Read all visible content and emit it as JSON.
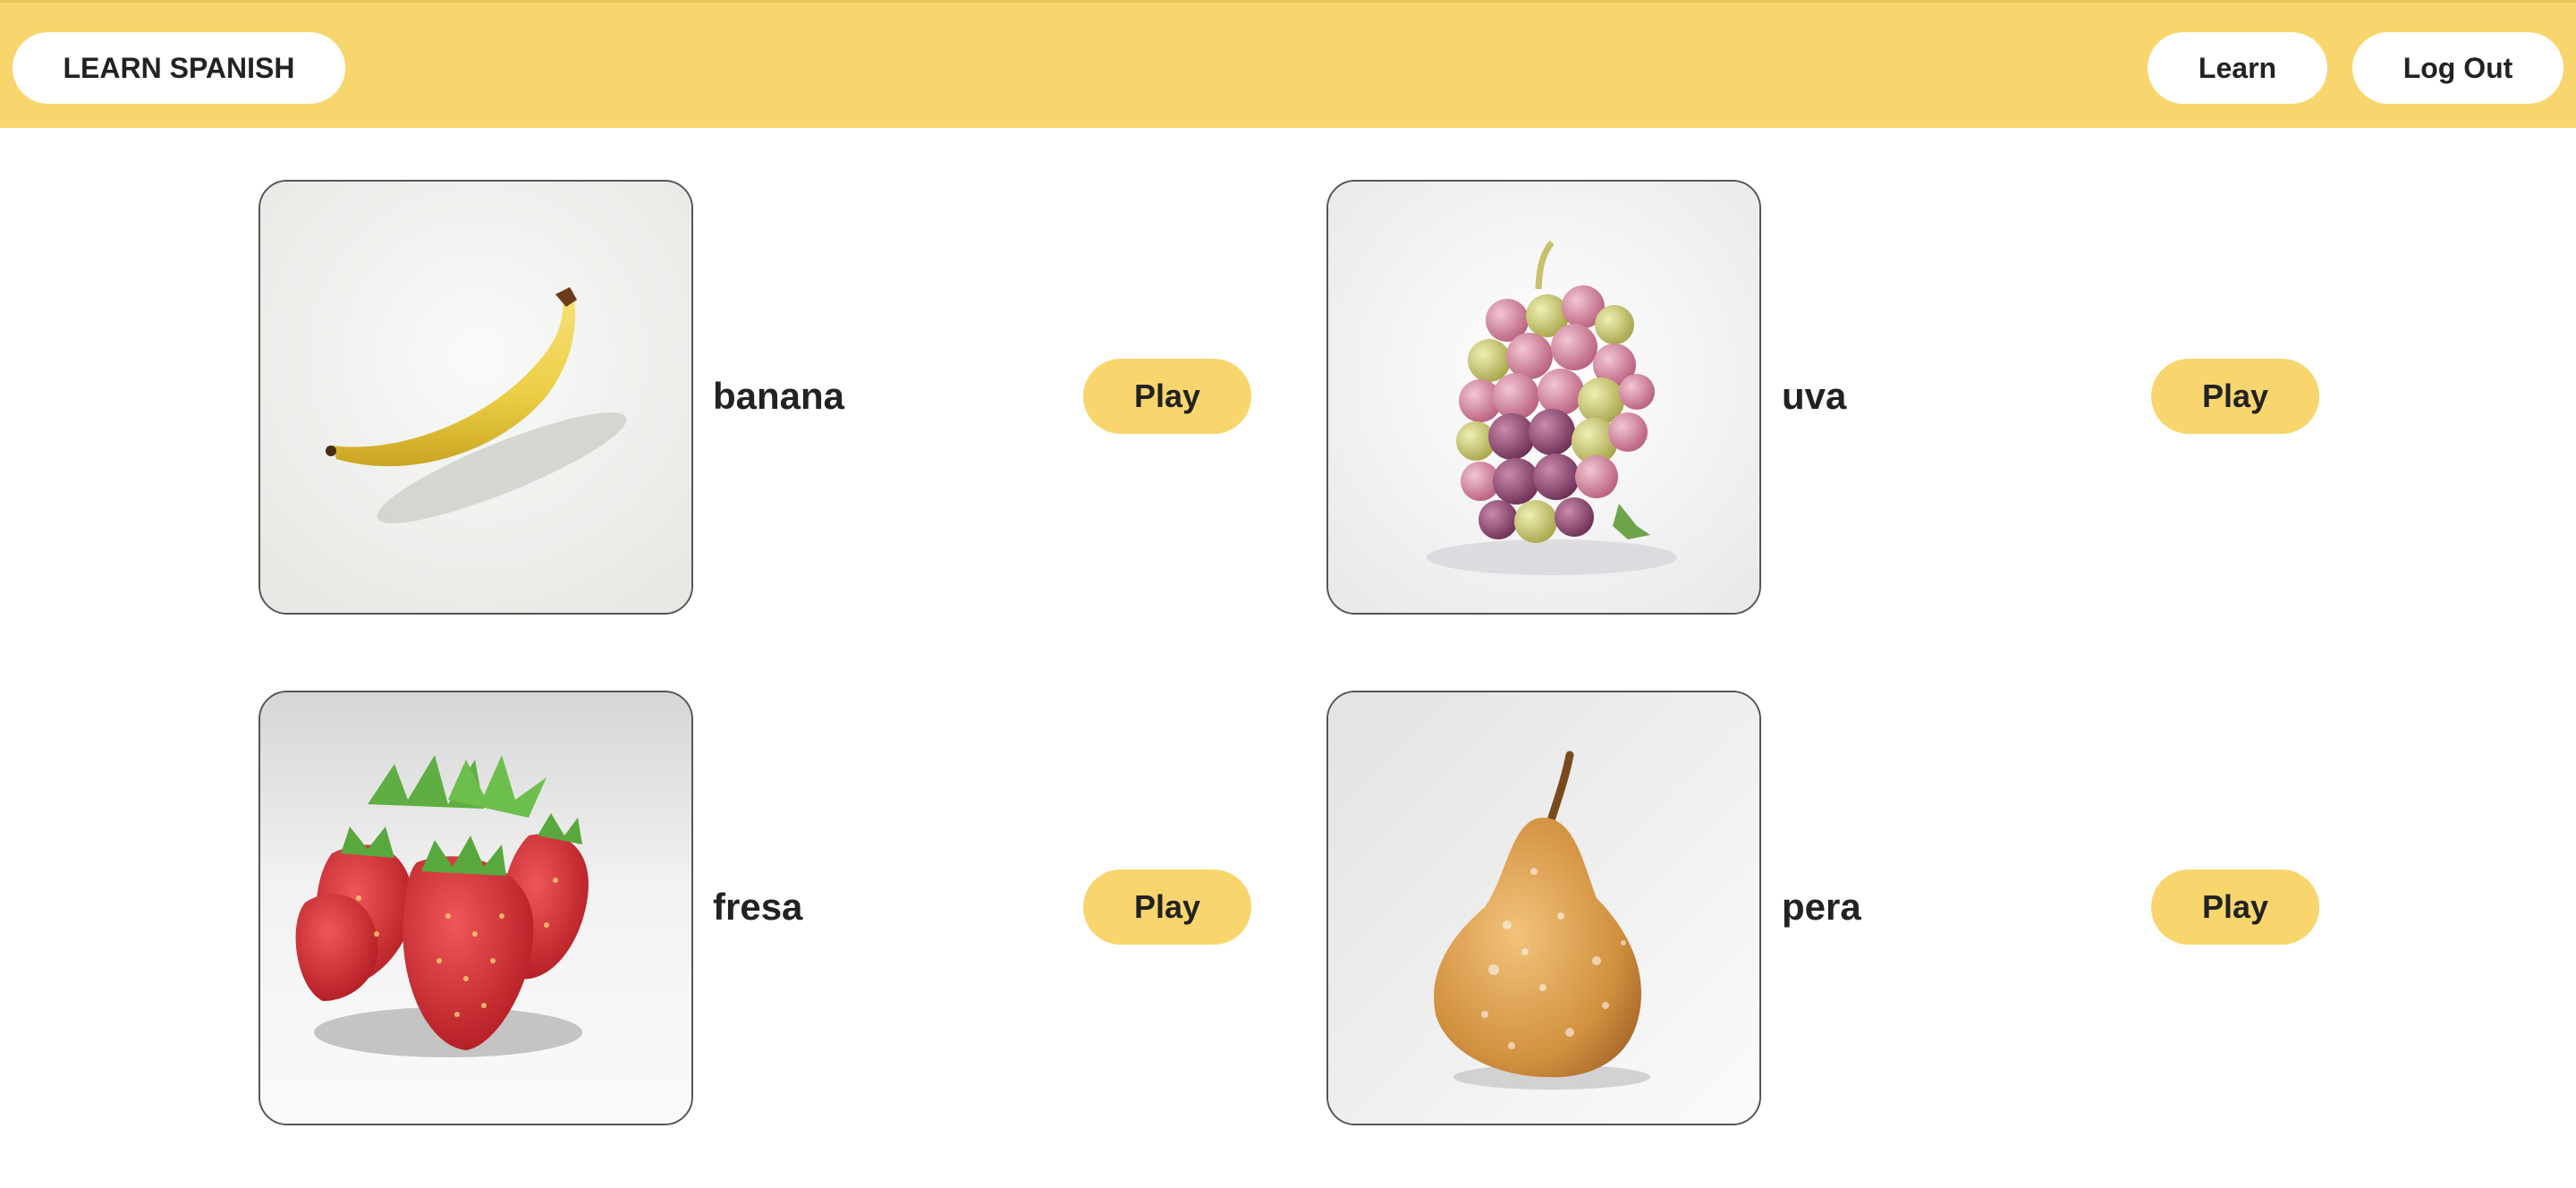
{
  "header": {
    "logo_label": "LEARN SPANISH",
    "learn_label": "Learn",
    "logout_label": "Log Out",
    "background_color": "#f8d66d"
  },
  "cards": [
    {
      "word": "banana",
      "play_label": "Play",
      "image_icon": "banana-image"
    },
    {
      "word": "uva",
      "play_label": "Play",
      "image_icon": "grapes-image"
    },
    {
      "word": "fresa",
      "play_label": "Play",
      "image_icon": "strawberries-image"
    },
    {
      "word": "pera",
      "play_label": "Play",
      "image_icon": "pear-image"
    }
  ],
  "colors": {
    "accent": "#f8d66d",
    "text": "#222222"
  }
}
